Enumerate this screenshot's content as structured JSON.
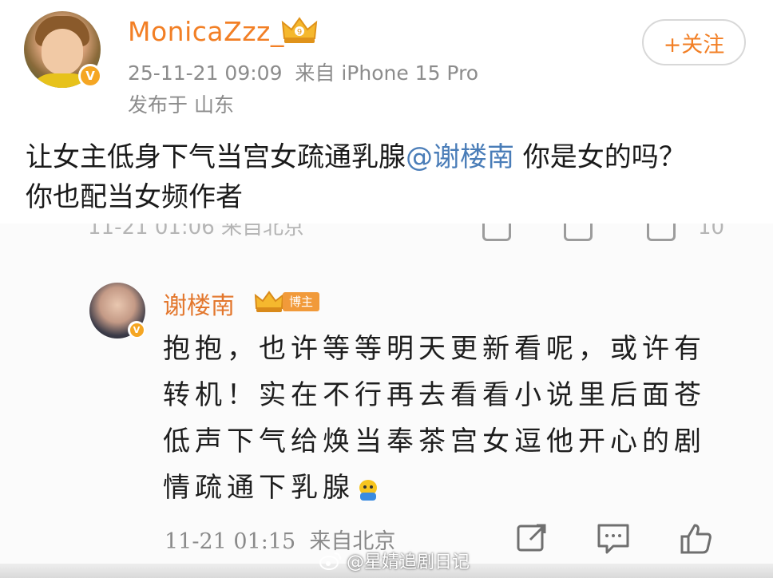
{
  "post": {
    "username": "MonicaZzz_",
    "timestamp": "25-11-21 09:09",
    "source": "来自 iPhone 15 Pro",
    "location": "发布于 山东",
    "follow_label": "+关注",
    "text_part1": "让女主低身下气当宫女疏通乳腺",
    "mention": "@谢楼南",
    "text_part2": " 你是女的吗？",
    "text_line2": "你也配当女频作者"
  },
  "embedded_reply": {
    "cut_off_row": "11-21 01:06  来自北京",
    "cut_off_count": "10",
    "author": "谢楼南",
    "author_tag": "博主",
    "text": "抱抱，也许等等明天更新看呢，或许有转机！实在不行再去看看小说里后面苍低声下气给焕当奉茶宫女逗他开心的剧情疏通下乳腺",
    "time": "11-21 01:15",
    "source": "来自北京"
  },
  "watermark": {
    "text": "@星婧追剧日记"
  },
  "colors": {
    "username": "#f27f25",
    "mention": "#4a7db8",
    "meta": "#8c8c8c",
    "verified_badge": "#f5a623"
  },
  "icons": [
    "verified-badge-icon",
    "crown-icon",
    "share-icon",
    "comment-icon",
    "like-icon",
    "weibo-logo-icon",
    "emoji-icon"
  ]
}
